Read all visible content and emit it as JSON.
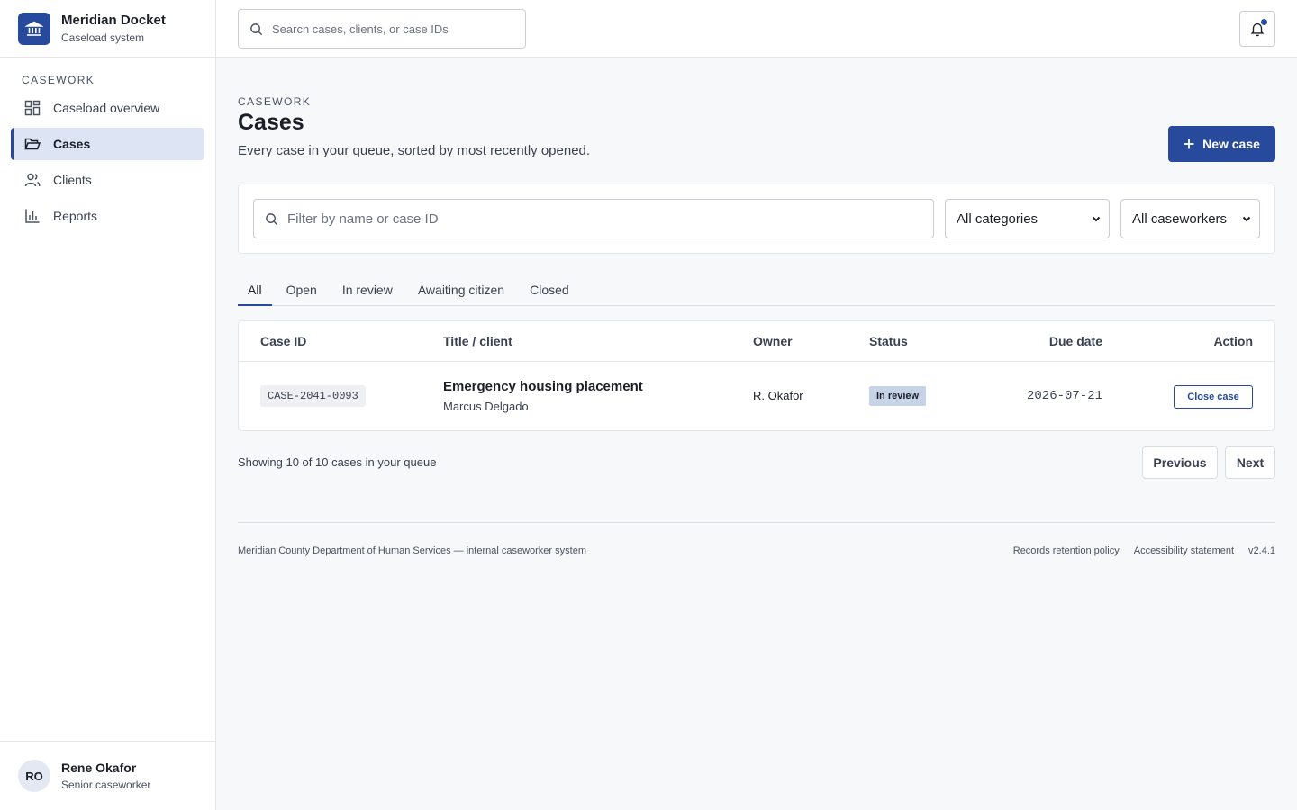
{
  "app": {
    "name": "Meridian Docket",
    "subtitle": "Caseload system"
  },
  "sidebar": {
    "section_label": "CASEWORK",
    "items": [
      {
        "label": "Caseload overview",
        "icon": "grid-icon",
        "active": false
      },
      {
        "label": "Cases",
        "icon": "folder-open-icon",
        "active": true
      },
      {
        "label": "Clients",
        "icon": "users-icon",
        "active": false
      },
      {
        "label": "Reports",
        "icon": "bar-chart-icon",
        "active": false
      }
    ]
  },
  "user": {
    "initials": "RO",
    "name": "Rene Okafor",
    "role": "Senior caseworker"
  },
  "topbar": {
    "search_placeholder": "Search cases, clients, or case IDs",
    "notification_unread": true
  },
  "page": {
    "eyebrow": "CASEWORK",
    "title": "Cases",
    "description": "Every case in your queue, sorted by most recently opened.",
    "new_case_label": "New case"
  },
  "filters": {
    "search_placeholder": "Filter by name or case ID",
    "category_selected": "All categories",
    "caseworker_selected": "All caseworkers"
  },
  "tabs": [
    {
      "label": "All",
      "active": true
    },
    {
      "label": "Open",
      "active": false
    },
    {
      "label": "In review",
      "active": false
    },
    {
      "label": "Awaiting citizen",
      "active": false
    },
    {
      "label": "Closed",
      "active": false
    }
  ],
  "table": {
    "headers": {
      "case_id": "Case ID",
      "title": "Title / client",
      "owner": "Owner",
      "status": "Status",
      "due": "Due date",
      "action": "Action"
    },
    "rows": [
      {
        "case_id": "CASE-2041-0093",
        "title": "Emergency housing placement",
        "client": "Marcus Delgado",
        "owner": "R. Okafor",
        "status": "In review",
        "due": "2026-07-21",
        "action": "Close case"
      }
    ]
  },
  "pagination": {
    "summary": "Showing 10 of 10 cases in your queue",
    "previous": "Previous",
    "next": "Next"
  },
  "footer": {
    "org": "Meridian County Department of Human Services — internal caseworker system",
    "links": [
      "Records retention policy",
      "Accessibility statement"
    ],
    "version": "v2.4.1"
  },
  "colors": {
    "brand": "#274a9c",
    "status_in_review_bg": "#c7d3e6",
    "active_nav_bg": "#dde5f4"
  }
}
